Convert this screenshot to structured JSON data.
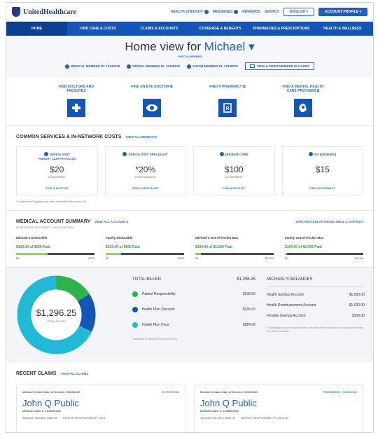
{
  "header": {
    "logo_text": "UnitedHealthcare",
    "links": [
      "HEALTH CHECKUP",
      "MESSAGES",
      "REWARDS",
      "SEARCH"
    ],
    "english_label": "ENGLISH",
    "account_label": "ACCOUNT PROFILE"
  },
  "nav": {
    "items": [
      {
        "label": "HOME"
      },
      {
        "label": "FIND CARE & COSTS"
      },
      {
        "label": "CLAIMS & ACCOUNTS"
      },
      {
        "label": "COVERAGE & BENEFITS"
      },
      {
        "label": "PHARMACIES & PRESCRIPTIONS"
      },
      {
        "label": "HEALTH & WELLNESS"
      }
    ]
  },
  "hero": {
    "title_prefix": "Home view for",
    "member_name": "Michael",
    "switch_label": "SWITCH MEMBER",
    "ids": [
      {
        "label": "MEDICAL MEMBER ID: 12345678"
      },
      {
        "label": "DENTAL MEMBER ID: 12345678"
      },
      {
        "label": "VISION MEMBER ID: 12345678"
      }
    ],
    "print_label": "VIEW & PRINT MEMBER ID CARDS"
  },
  "quick_actions": [
    {
      "label": "FIND DOCTORS AND FACILITIES",
      "icon": "plus-icon"
    },
    {
      "label": "FIND AN EYE DOCTOR",
      "icon": "eye-icon"
    },
    {
      "label": "FIND A PHARMACY",
      "icon": "pharmacy-icon"
    },
    {
      "label": "FIND A MENTAL HEALTH CARE PROVIDER",
      "icon": "head-icon"
    }
  ],
  "services": {
    "title": "COMMON SERVICES & IN-NETWORK COSTS",
    "view_link": "VIEW ALL BENEFITS",
    "cards": [
      {
        "name": "OFFICE VISIT",
        "sub": "PRIMARY CARE PHYSICIAN",
        "amount": "$20",
        "kind": "COPAYMENT",
        "link": "FIND A DOCTOR"
      },
      {
        "name": "OFFICE VISIT SPECIALIST",
        "sub": "",
        "amount": "*20%",
        "kind": "COINSURANCE",
        "link": "FIND A SPECIALIST"
      },
      {
        "name": "URGENT CARE",
        "sub": "",
        "amount": "$100",
        "kind": "COPAYMENT",
        "link": "FIND A FACILITY"
      },
      {
        "name": "RX (GENERIC)",
        "sub": "",
        "amount": "$15",
        "kind": "",
        "link": "FIND A PHARMACY"
      }
    ],
    "note": "*Coinsurance applies only after deductible has been met."
  },
  "medical_summary": {
    "title": "MEDICAL ACCOUNT SUMMARY",
    "view_link": "VIEW ALL ACCOUNTS",
    "sub": "IN NETWORK ACCOUNTS - As of 01/01/2016",
    "compare_link": "EXPLANATION OF DEDUCTIBLE & OOP MAX",
    "bars": [
      {
        "title": "Michael's Deductible",
        "paid": "$100.00 of $250 Paid",
        "start": "$0",
        "end": "$250",
        "fraction": 0.4
      },
      {
        "title": "Family Deductible",
        "paid": "$100.00 of $500 Paid",
        "start": "$0",
        "end": "$500",
        "fraction": 0.2
      },
      {
        "title": "Michael's Out-of-Pocket Max",
        "paid": "$100.00 of $1,500 Paid",
        "start": "$0",
        "end": "$1,500",
        "fraction": 0.07
      },
      {
        "title": "Family Out-of-Pocket Max",
        "paid": "$100.00 of $3,000 Paid",
        "start": "$0",
        "end": "$3,000",
        "fraction": 0.03
      }
    ]
  },
  "billing": {
    "center_amount": "$1,296.25",
    "center_label": "TOTAL BILLED",
    "total_label": "TOTAL BILLED",
    "total_value": "$1,296.25",
    "rows": [
      {
        "label": "Patient Responsibility",
        "value": "$206.00",
        "color": "#2db34a",
        "share": 0.16
      },
      {
        "label": "Health Plan Discount",
        "value": "$206.00",
        "color": "#1456b8",
        "share": 0.16
      },
      {
        "label": "Health Plan Pays",
        "value": "$884.25",
        "color": "#21b9d6",
        "share": 0.68
      }
    ],
    "note": "Total Billed For Michael From 01/01/2016"
  },
  "balances": {
    "title": "MICHAEL'S BALANCES",
    "rows": [
      {
        "label": "Health Savings Account",
        "value": "$1,000.00"
      },
      {
        "label": "Health Reimbursement Account",
        "value": "$1,000.00"
      },
      {
        "label": "Flexible Savings Account",
        "value": "$100.00"
      }
    ],
    "note": "* Depending on your account balance, you may be able to cover your out-of-pocket costs from these accounts"
  },
  "claims": {
    "title": "RECENT CLAIMS",
    "view_link": "VIEW ALL CLAIMS",
    "cards": [
      {
        "service": "Michael's Claim Date of Service: 06/15/2016",
        "status": "IN PROCESS",
        "status_green": false,
        "name": "John Q Public",
        "number": "Medical Claim #: 1234567890",
        "billed": "AMOUNT BILLED | $360.00",
        "resp": "PATIENT RESPONSIBILITY | N/A"
      },
      {
        "service": "Michael's Claim Date of Service: 06/10/2016",
        "status": "PROCESSED • 05/30/2016",
        "status_green": true,
        "name": "John Q Public",
        "number": "Medical Claim #: 1234567890",
        "billed": "AMOUNT BILLED | $600.00",
        "resp": "PATIENT RESPONSIBILITY | $100.00"
      }
    ]
  }
}
